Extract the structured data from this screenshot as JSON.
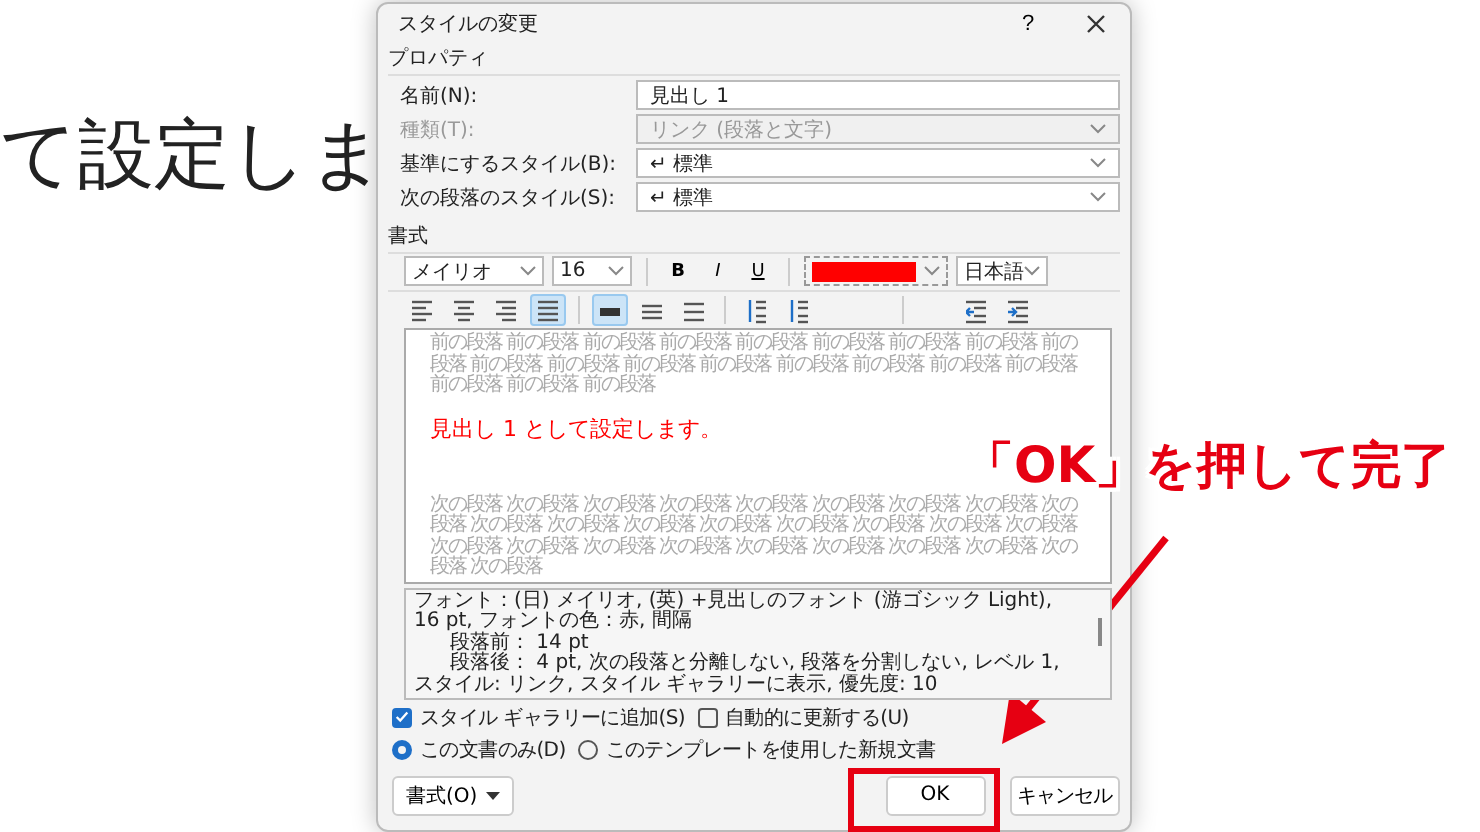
{
  "background_text": "て設定しま",
  "dialog": {
    "title": "スタイルの変更",
    "help": "?",
    "properties": {
      "heading": "プロパティ",
      "fields": [
        {
          "label": "名前(N):",
          "value": "見出し 1",
          "kind": "text",
          "disabled": false
        },
        {
          "label": "種類(T):",
          "value": "リンク (段落と文字)",
          "kind": "select",
          "disabled": true
        },
        {
          "label": "基準にするスタイル(B):",
          "value": "↵ 標準",
          "kind": "select",
          "disabled": false
        },
        {
          "label": "次の段落のスタイル(S):",
          "value": "↵ 標準",
          "kind": "select",
          "disabled": false
        }
      ]
    },
    "formatting": {
      "heading": "書式",
      "font": "メイリオ",
      "size": "16",
      "styles": [
        "B",
        "I",
        "U"
      ],
      "font_color": {
        "color": "#ff0000"
      },
      "language": "日本語",
      "paragraph_tools": [
        {
          "kind": "align-left",
          "selected": false
        },
        {
          "kind": "align-center",
          "selected": false
        },
        {
          "kind": "align-right",
          "selected": false
        },
        {
          "kind": "justify",
          "selected": true
        },
        {
          "kind": "single",
          "selected": true
        },
        {
          "kind": "one-half",
          "selected": false
        },
        {
          "kind": "double",
          "selected": false
        },
        {
          "kind": "space-up",
          "selected": false
        },
        {
          "kind": "space-down",
          "selected": false
        },
        {
          "kind": "outdent",
          "selected": false
        },
        {
          "kind": "indent",
          "selected": false
        }
      ]
    },
    "preview": {
      "previous": [
        "前の段落 前の段落 前の段落 前の段落 前の段落 前の段落 前の段落 前の段落 前の",
        "段落 前の段落 前の段落 前の段落 前の段落 前の段落 前の段落 前の段落 前の段落",
        "前の段落 前の段落 前の段落"
      ],
      "sample": "見出し 1 として設定します。",
      "next": [
        "次の段落 次の段落 次の段落 次の段落 次の段落 次の段落 次の段落 次の段落 次の",
        "段落 次の段落 次の段落 次の段落 次の段落 次の段落 次の段落 次の段落 次の段落",
        "次の段落 次の段落 次の段落 次の段落 次の段落 次の段落 次の段落 次の段落 次の",
        "段落 次の段落"
      ]
    },
    "description": [
      "フォント：(日) メイリオ, (英) +見出しのフォント (游ゴシック Light), 16 pt, フォントの色：赤, 間隔",
      "段落前： 14 pt",
      "段落後： 4 pt, 次の段落と分離しない, 段落を分割しない, レベル 1, スタイル: リンク, スタイル ギャラリーに表示, 優先度: 10"
    ],
    "checkboxes": [
      {
        "label": "スタイル ギャラリーに追加(S)",
        "checked": true
      },
      {
        "label": "自動的に更新する(U)",
        "checked": false
      }
    ],
    "radios": [
      {
        "label": "この文書のみ(D)",
        "selected": true
      },
      {
        "label": "このテンプレートを使用した新規文書",
        "selected": false
      }
    ],
    "format_button": "書式(O)",
    "ok": "OK",
    "cancel": "キャンセル"
  },
  "annotation": {
    "text": "「OK」を押して完了"
  }
}
